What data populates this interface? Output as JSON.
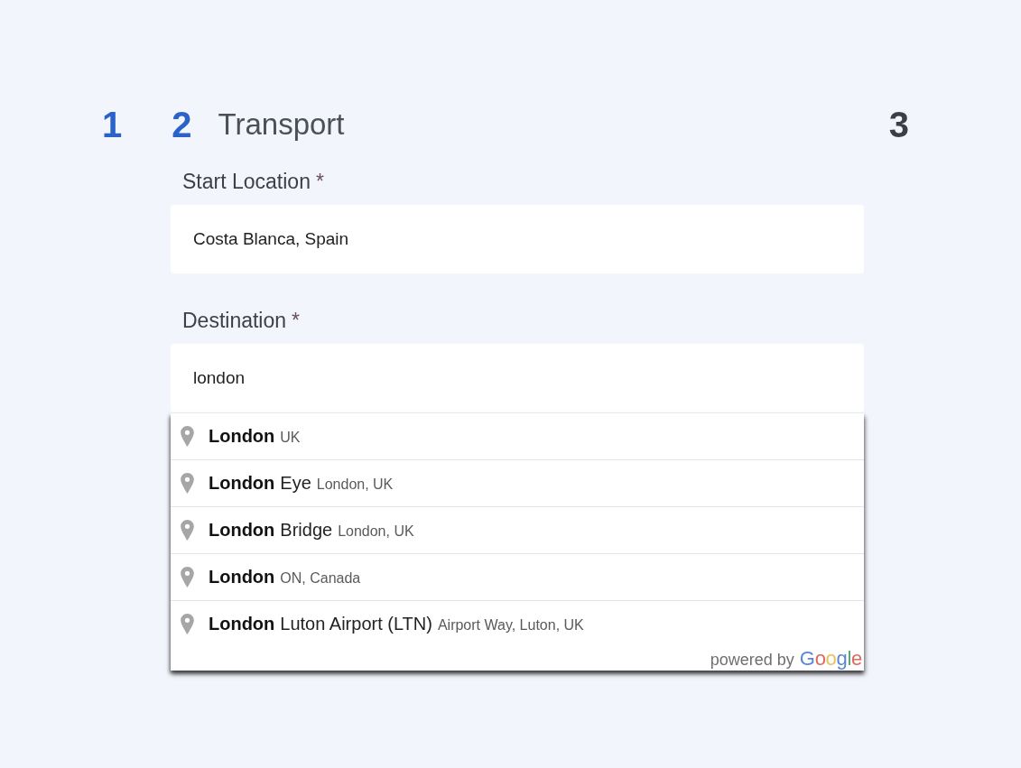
{
  "steps": [
    {
      "number": "1",
      "active": true
    },
    {
      "number": "2",
      "title": "Transport",
      "active": true
    },
    {
      "number": "3",
      "active": false
    }
  ],
  "fields": [
    {
      "label": "Start Location",
      "required_mark": "*",
      "value": "Costa Blanca, Spain"
    },
    {
      "label": "Destination",
      "required_mark": "*",
      "value": "london",
      "suggestions": [
        {
          "match": "London",
          "secondary": "UK",
          "selected": false
        },
        {
          "match": "London",
          "rest": "Eye",
          "secondary": "London, UK",
          "selected": false
        },
        {
          "match": "London",
          "rest": "Bridge",
          "secondary": "London, UK",
          "selected": false
        },
        {
          "match": "London",
          "secondary": "ON, Canada",
          "selected": false
        },
        {
          "match": "London",
          "rest": "Luton Airport (LTN)",
          "secondary": "Airport Way, Luton, UK",
          "selected": false
        }
      ],
      "attribution": {
        "prefix": "powered by",
        "logo": "Google"
      }
    }
  ]
}
